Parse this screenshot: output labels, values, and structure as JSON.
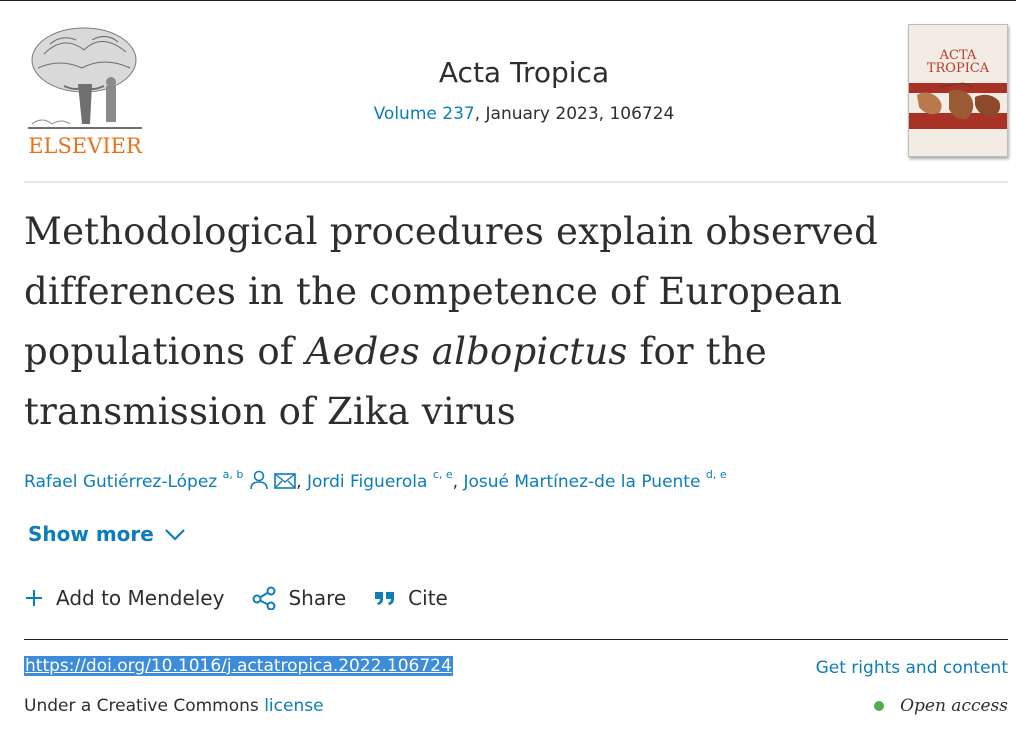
{
  "header": {
    "publisher_logo_text": "ELSEVIER",
    "journal_title": "Acta Tropica",
    "volume_link": "Volume 237",
    "issue_details": ", January 2023, 106724",
    "cover_title_line1": "ACTA",
    "cover_title_line2": "TROPICA"
  },
  "article": {
    "title_part1": "Methodological procedures explain observed differences in the competence of European populations of ",
    "title_italic": "Aedes albopictus",
    "title_part2": " for the transmission of Zika virus"
  },
  "authors": [
    {
      "name": "Rafael Gutiérrez-López",
      "affiliations": "a, b"
    },
    {
      "name": "Jordi Figuerola",
      "affiliations": "c, e"
    },
    {
      "name": "Josué Martínez-de la Puente",
      "affiliations": "d, e"
    }
  ],
  "show_more_label": "Show more",
  "actions": {
    "mendeley": "Add to Mendeley",
    "share": "Share",
    "cite": "Cite"
  },
  "doi": "https://doi.org/10.1016/j.actatropica.2022.106724",
  "rights_link": "Get rights and content",
  "license_prefix": "Under a Creative Commons ",
  "license_link": "license",
  "open_access": "Open access",
  "colors": {
    "link": "#0c7dbb",
    "elsevier_orange": "#e9711c",
    "open_access_green": "#4caf50",
    "doi_highlight": "#3d8bdb"
  }
}
